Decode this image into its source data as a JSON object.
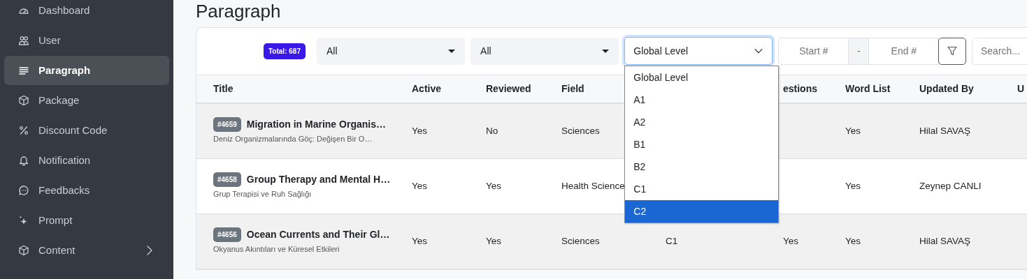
{
  "sidebar": {
    "items": [
      {
        "label": "Dashboard",
        "selected": false,
        "has_submenu": false
      },
      {
        "label": "User",
        "selected": false,
        "has_submenu": false
      },
      {
        "label": "Paragraph",
        "selected": true,
        "has_submenu": false
      },
      {
        "label": "Package",
        "selected": false,
        "has_submenu": false
      },
      {
        "label": "Discount Code",
        "selected": false,
        "has_submenu": false
      },
      {
        "label": "Notification",
        "selected": false,
        "has_submenu": false
      },
      {
        "label": "Feedbacks",
        "selected": false,
        "has_submenu": false
      },
      {
        "label": "Prompt",
        "selected": false,
        "has_submenu": false
      },
      {
        "label": "Content",
        "selected": false,
        "has_submenu": true
      }
    ]
  },
  "page_title": "Paragraph",
  "filters": {
    "total_badge": "Total: 687",
    "select_1": "All",
    "select_2": "All",
    "level_select": {
      "value": "Global Level",
      "expanded": true,
      "options": [
        {
          "label": "Global Level",
          "highlighted": false
        },
        {
          "label": "A1",
          "highlighted": false
        },
        {
          "label": "A2",
          "highlighted": false
        },
        {
          "label": "B1",
          "highlighted": false
        },
        {
          "label": "B2",
          "highlighted": false
        },
        {
          "label": "C1",
          "highlighted": false
        },
        {
          "label": "C2",
          "highlighted": true
        }
      ]
    },
    "start_placeholder": "Start #",
    "separator": "-",
    "end_placeholder": "End #",
    "search_placeholder": "Search..."
  },
  "table": {
    "columns": [
      "Title",
      "Active",
      "Reviewed",
      "Field",
      "",
      "estions",
      "Word List",
      "Updated By",
      "U"
    ],
    "rows": [
      {
        "id": "#4659",
        "title": "Migration in Marine Organis…",
        "subtitle": "Deniz Organizmalarında Göç: Değişen Bir O…",
        "active": "Yes",
        "reviewed": "No",
        "field": "Sciences",
        "word_list": "Yes",
        "updated_by": "Hilal SAVAŞ"
      },
      {
        "id": "#4658",
        "title": "Group Therapy and Mental H…",
        "subtitle": "Grup Terapisi ve Ruh Sağlığı",
        "active": "Yes",
        "reviewed": "Yes",
        "field": "Health Science",
        "word_list": "Yes",
        "updated_by": "Zeynep CANLI"
      },
      {
        "id": "#4656",
        "title": "Ocean Currents and Their Gl…",
        "subtitle": "Okyanus Akıntıları ve Küresel Etkileri",
        "active": "Yes",
        "reviewed": "Yes",
        "field": "Sciences",
        "column_5": "C1",
        "questions": "Yes",
        "word_list": "Yes",
        "updated_by": "Hilal SAVAŞ"
      }
    ]
  }
}
